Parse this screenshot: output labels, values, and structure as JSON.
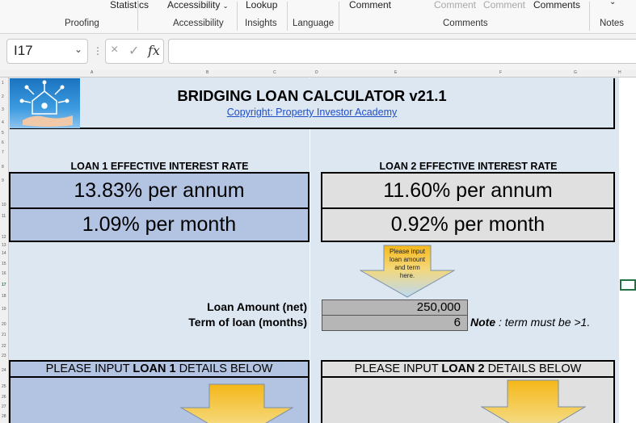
{
  "ribbon": {
    "items": {
      "statistics": "Statistics",
      "accessibility": "Accessibility",
      "lookup": "Lookup",
      "comment": "Comment",
      "comment_dim1": "Comment",
      "comment_dim2": "Comment",
      "comments": "Comments"
    },
    "groups": {
      "proofing": "Proofing",
      "accessibility": "Accessibility",
      "insights": "Insights",
      "language": "Language",
      "comments": "Comments",
      "notes": "Notes"
    }
  },
  "formula_bar": {
    "name_box": "I17",
    "cancel_icon": "×",
    "enter_icon": "✓",
    "fx_label": "fx",
    "formula": ""
  },
  "columns": [
    "A",
    "B",
    "C",
    "D",
    "E",
    "F",
    "G",
    "H"
  ],
  "rows": [
    "1",
    "2",
    "3",
    "4",
    "5",
    "6",
    "7",
    "8",
    "9",
    "10",
    "11",
    "12",
    "13",
    "14",
    "15",
    "16",
    "17",
    "18",
    "19",
    "20",
    "21",
    "22",
    "23",
    "24",
    "25",
    "26",
    "27",
    "28"
  ],
  "sheet": {
    "title": "BRIDGING LOAN CALCULATOR v21.1",
    "copyright": "Copyright: Property Investor Academy",
    "loan1": {
      "label": "LOAN 1 EFFECTIVE INTEREST RATE",
      "annual": "13.83% per annum",
      "monthly": "1.09% per month",
      "details_pre": "PLEASE INPUT ",
      "details_bold": "LOAN 1",
      "details_post": " DETAILS BELOW"
    },
    "loan2": {
      "label": "LOAN 2 EFFECTIVE INTEREST RATE",
      "annual": "11.60% per annum",
      "monthly": "0.92% per month",
      "details_pre": "PLEASE  INPUT ",
      "details_bold": "LOAN 2",
      "details_post": " DETAILS BELOW"
    },
    "arrow_note": "Please input loan amount and term here.",
    "loan_amount_label": "Loan Amount (net)",
    "loan_amount_value": "250,000",
    "term_label": "Term of loan (months)",
    "term_value": "6",
    "note_bold": "Note",
    "note_text": " : term must be >1."
  },
  "colors": {
    "sheet_bg": "#dde7f2",
    "loan1_box": "#b3c3e2",
    "loan2_box": "#e0e0e0",
    "input_cell": "#b6b6b6",
    "link": "#1f4fc5",
    "arrow_top": "#f5b718",
    "arrow_bottom": "#bcd9f2"
  }
}
